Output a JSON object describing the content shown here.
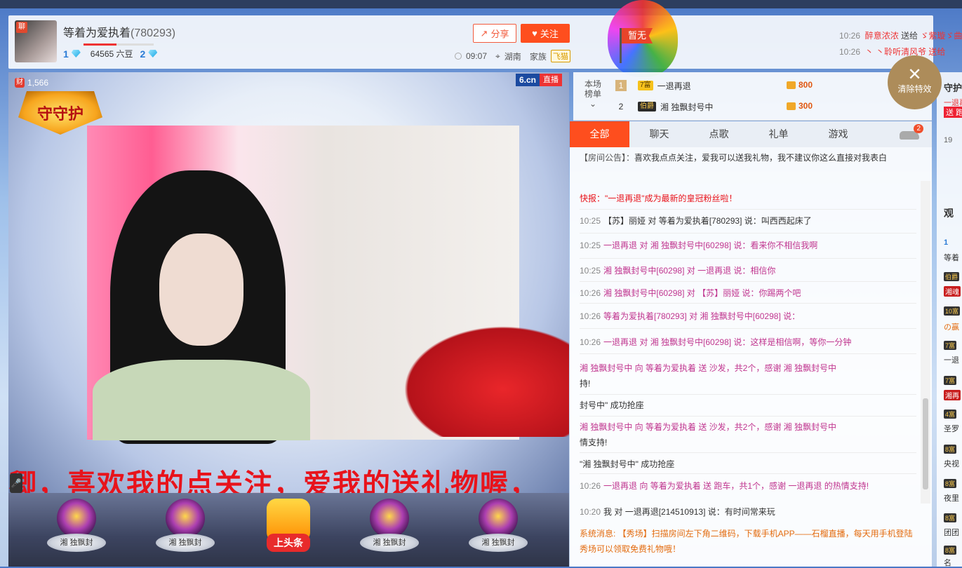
{
  "host": {
    "avatar_tag": "聊",
    "name": "等着为爱执着",
    "room_id": "(780293)",
    "level": "1",
    "beans": "64565 六豆",
    "fans_level": "2",
    "time": "09:07",
    "location": "湖南",
    "family_label": "家族",
    "family": "飞猫",
    "progress": 0.47
  },
  "buttons": {
    "share": "分享",
    "follow": "关注"
  },
  "flag_label": "暂无",
  "gift_feed": [
    {
      "time": "10:26",
      "from": "醉意浓浓",
      "action": "送给",
      "to": "ゞ紫璇ゞ曲"
    },
    {
      "time": "10:26",
      "from": "丶",
      "action": "",
      "to": "丶聆听清风爷 送给"
    }
  ],
  "video": {
    "rich_icon": "财",
    "rich_count": "1,566",
    "guard_badge": "守守护",
    "logo": "6.cn",
    "live": "直播",
    "scroll_text": "卿，喜欢我的点关注，爱我的送礼物喔，",
    "mic_icon": "mic-icon"
  },
  "seats": [
    {
      "label": "湘   独飘封"
    },
    {
      "label": "湘   独飘封"
    },
    {
      "label": "上头条"
    },
    {
      "label": "湘   独飘封"
    },
    {
      "label": "湘   独飘封"
    }
  ],
  "rank": {
    "title": "本场榜单",
    "rows": [
      {
        "no": "1",
        "tag": "7富",
        "name": "一退再退",
        "coins": "800"
      },
      {
        "no": "2",
        "tag": "伯爵",
        "name": "湘   独飘封号中",
        "coins": "300"
      }
    ]
  },
  "tabs": [
    {
      "label": "全部"
    },
    {
      "label": "聊天"
    },
    {
      "label": "点歌"
    },
    {
      "label": "礼单"
    },
    {
      "label": "游戏"
    }
  ],
  "car_badge": "2",
  "notice": {
    "label": "【房间公告】：",
    "text": "喜欢我点点关注，爱我可以送我礼物，我不建议你这么直接对我表白"
  },
  "messages": [
    {
      "text": "快报：\"一退再退\"成为最新的皇冠粉丝啦！"
    },
    {
      "time": "10:25",
      "text": "【苏】丽娅 对 等着为爱执着[780293] 说：叫西西起床了"
    },
    {
      "time": "10:25",
      "text": "一退再退 对 湘   独飘封号中[60298] 说：看来你不相信我啊"
    },
    {
      "time": "10:25",
      "text": "湘   独飘封号中[60298] 对 一退再退 说：相信你"
    },
    {
      "time": "10:26",
      "text": "湘   独飘封号中[60298] 对 【苏】丽娅 说：你踢两个吧"
    },
    {
      "time": "10:26",
      "text": "等着为爱执着[780293] 对 湘   独飘封号中[60298] 说："
    },
    {
      "time": "10:26",
      "text": "一退再退 对 湘   独飘封号中[60298] 说：这样是相信啊，等你一分钟"
    },
    {
      "text": "湘   独飘封号中 向 等着为爱执着 送 沙发，共2个，感谢 湘   独飘封号中"
    },
    {
      "text": "持!"
    },
    {
      "text": "封号中\" 成功抢座"
    },
    {
      "text": "湘   独飘封号中 向 等着为爱执着 送 沙发，共2个，感谢 湘   独飘封号中"
    },
    {
      "text": "情支持!"
    },
    {
      "text": "\"湘   独飘封号中\" 成功抢座"
    },
    {
      "time": "10:26",
      "text": "一退再退 向 等着为爱执着 送 跑车，共1个，感谢 一退再退 的热情支持!"
    }
  ],
  "my_message": {
    "time": "10:20",
    "text": "我 对 一退再退[214510913] 说：有时间常来玩"
  },
  "system_message": "系统消息: 【秀场】扫描房间左下角二维码，下载手机APP——石榴直播，每天用手机登陆秀场可以领取免费礼物哦！",
  "clear_effects": "清除特效",
  "right_panel": {
    "guard": "守护",
    "gift_from": "一退再退",
    "gift_car": "送 跑车",
    "count": "19",
    "watch": "观",
    "items": [
      "1",
      "等着",
      "伯爵",
      "湘魂",
      "10富",
      "の赢",
      "7富",
      "一退",
      "7富",
      "湘再",
      "4富",
      "圣罗",
      "8富",
      "央视",
      "8富",
      "夜里",
      "8富",
      "团团",
      "8富",
      "名"
    ]
  }
}
